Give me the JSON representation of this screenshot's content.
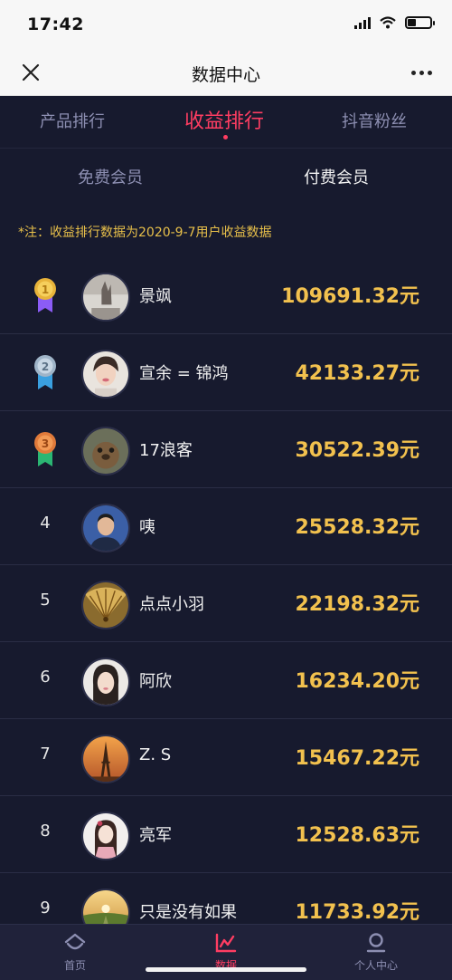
{
  "status_bar": {
    "time": "17:42"
  },
  "nav": {
    "title": "数据中心"
  },
  "tabs": [
    {
      "label": "产品排行",
      "active": false
    },
    {
      "label": "收益排行",
      "active": true
    },
    {
      "label": "抖音粉丝",
      "active": false
    }
  ],
  "subtabs": [
    {
      "label": "免费会员",
      "active": false
    },
    {
      "label": "付费会员",
      "active": true
    }
  ],
  "note": "*注：收益排行数据为2020-9-7用户收益数据",
  "ranking": [
    {
      "rank": "1",
      "medal": "gold",
      "name": "景飒",
      "amount": "109691.32元"
    },
    {
      "rank": "2",
      "medal": "silver",
      "name": "宣余 = 锦鸿",
      "amount": "42133.27元"
    },
    {
      "rank": "3",
      "medal": "bronze",
      "name": "17浪客",
      "amount": "30522.39元"
    },
    {
      "rank": "4",
      "name": "咦",
      "amount": "25528.32元"
    },
    {
      "rank": "5",
      "name": "点点小羽",
      "amount": "22198.32元"
    },
    {
      "rank": "6",
      "name": "阿欣",
      "amount": "16234.20元"
    },
    {
      "rank": "7",
      "name": "Z. S",
      "amount": "15467.22元"
    },
    {
      "rank": "8",
      "name": "亮军",
      "amount": "12528.63元"
    },
    {
      "rank": "9",
      "name": "只是没有如果",
      "amount": "11733.92元"
    }
  ],
  "bottom_nav": [
    {
      "label": "首页",
      "icon": "home-icon",
      "active": false
    },
    {
      "label": "数据",
      "icon": "chart-icon",
      "active": true
    },
    {
      "label": "个人中心",
      "icon": "profile-icon",
      "active": false
    }
  ],
  "colors": {
    "accent": "#ff3d62",
    "amount": "#f2c14e",
    "background": "#171a2e"
  }
}
